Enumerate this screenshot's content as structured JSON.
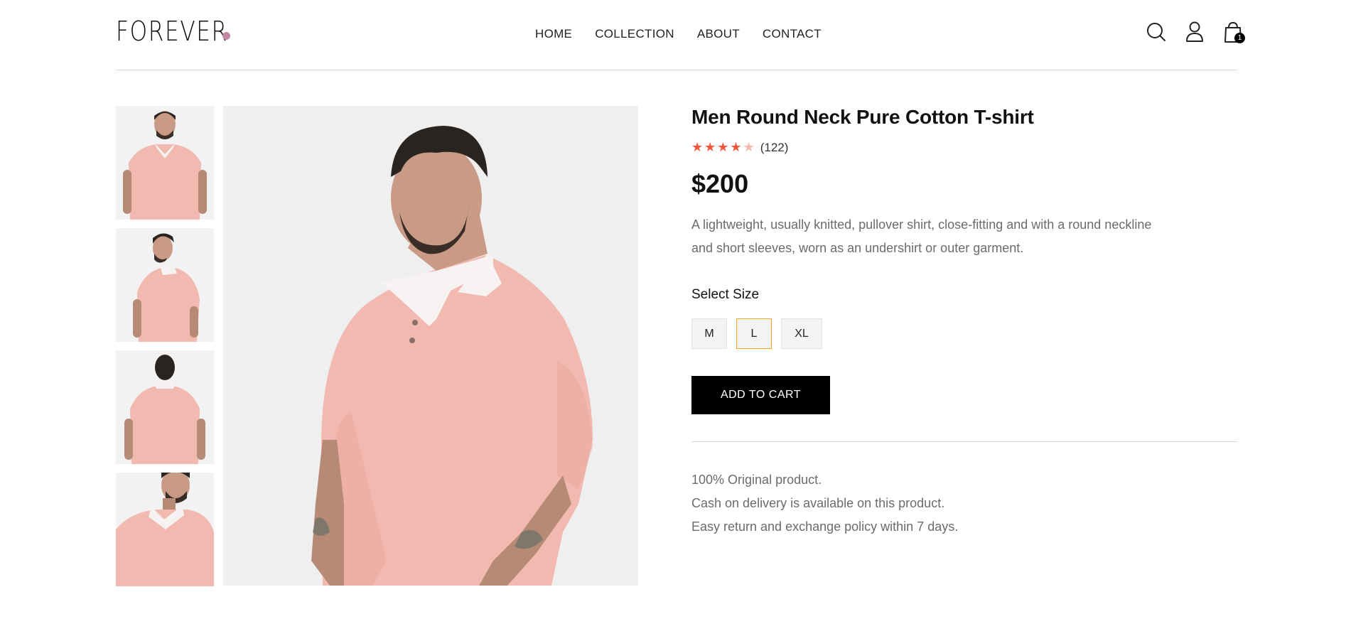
{
  "brand": {
    "logo_text": "FOREVER",
    "accent": "#c586a5"
  },
  "nav": {
    "items": [
      "HOME",
      "COLLECTION",
      "ABOUT",
      "CONTACT"
    ]
  },
  "header_icons": {
    "search": "search-icon",
    "profile": "user-icon",
    "cart": "shopping-bag-icon",
    "cart_count": "1"
  },
  "product": {
    "title": "Men Round Neck Pure Cotton T-shirt",
    "rating": 4,
    "rating_max": 5,
    "review_count": "(122)",
    "price": "$200",
    "description": "A lightweight, usually knitted, pullover shirt, close-fitting and with a round neckline and short sleeves, worn as an undershirt or outer garment.",
    "select_size_label": "Select Size",
    "sizes": [
      "M",
      "L",
      "XL"
    ],
    "selected_size": "L",
    "add_to_cart_label": "ADD TO CART",
    "policies": [
      "100% Original product.",
      "Cash on delivery is available on this product.",
      "Easy return and exchange policy within 7 days."
    ]
  },
  "colors": {
    "star": "#f4553b",
    "star_off": "#f8b7ad",
    "selected_border": "#f6a623",
    "shirt": "#f2b9b0"
  }
}
